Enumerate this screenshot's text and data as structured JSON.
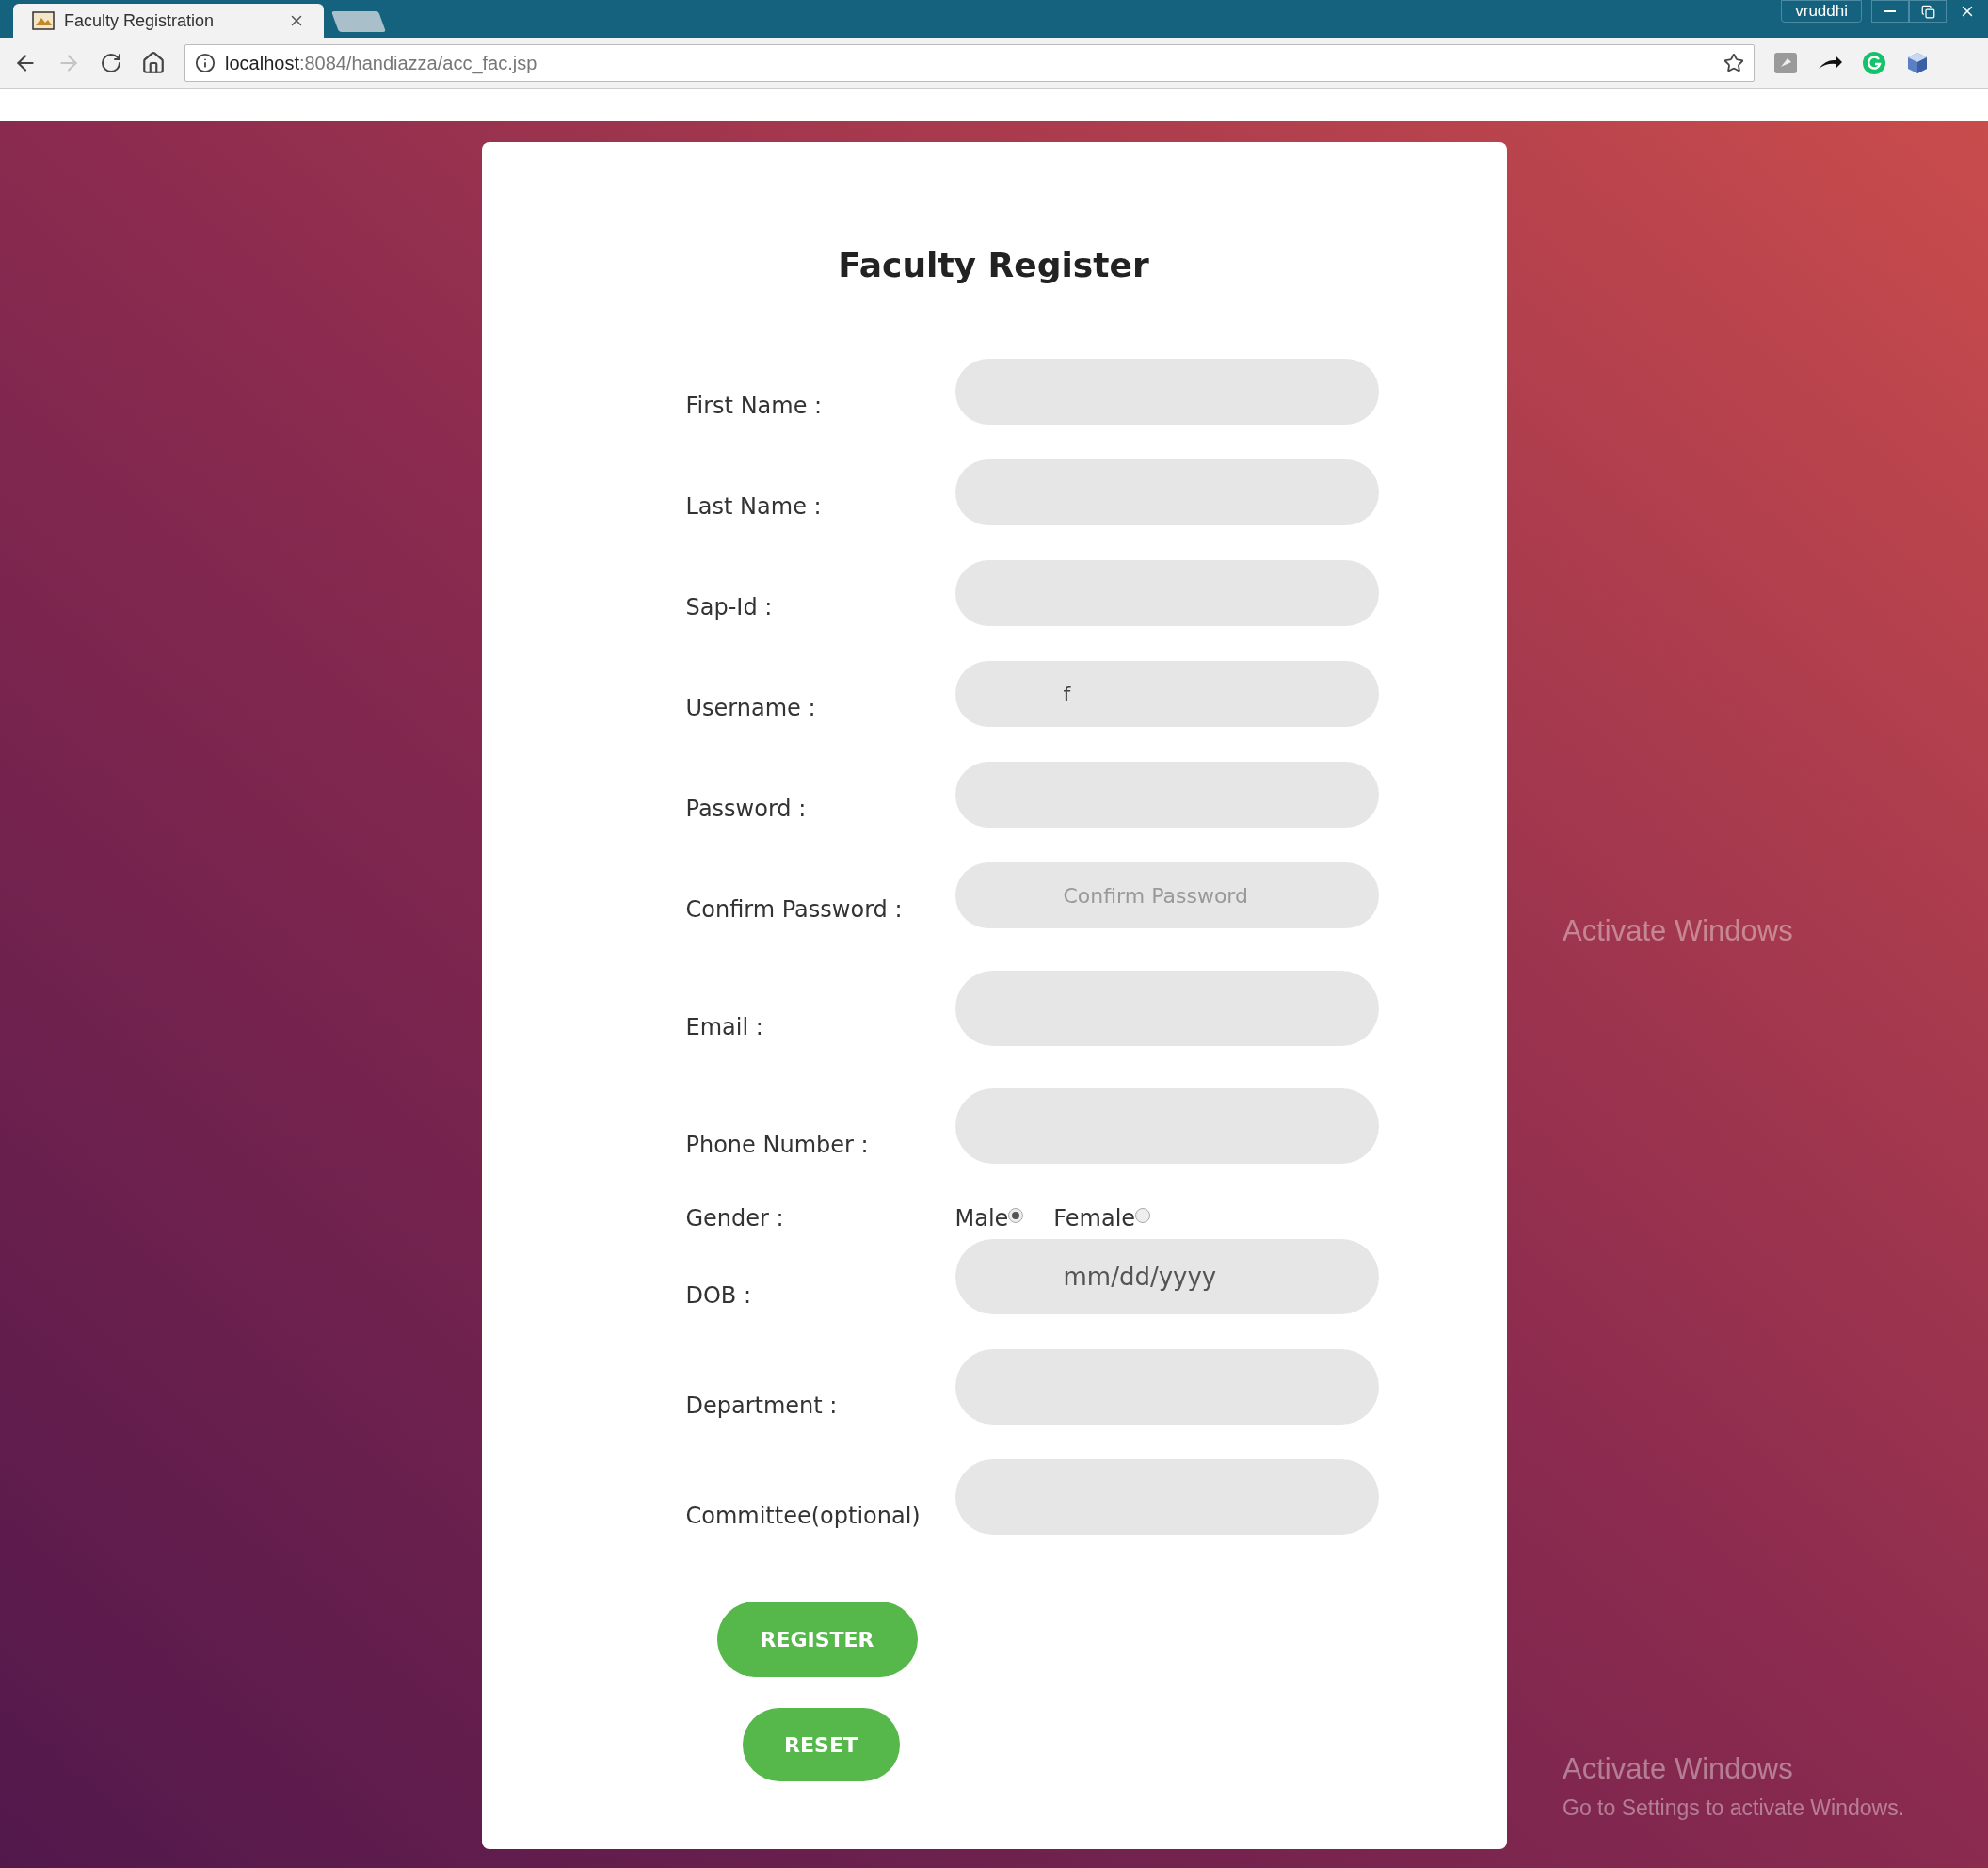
{
  "browser": {
    "tab": {
      "title": "Faculty Registration",
      "selected": true
    },
    "profile": "vruddhi",
    "navigation": {
      "back_disabled": false,
      "forward_disabled": true
    },
    "url": {
      "host": "localhost",
      "path": ":8084/handiazza/acc_fac.jsp"
    }
  },
  "form": {
    "title": "Faculty Register",
    "fields": [
      {
        "label": "First Name :",
        "kind": "text"
      },
      {
        "label": "Last Name :",
        "kind": "text"
      },
      {
        "label": "Sap-Id :",
        "kind": "text"
      },
      {
        "label": "Username :",
        "kind": "text",
        "value": "f"
      },
      {
        "label": "Password :",
        "kind": "text"
      },
      {
        "label": "Confirm Password :",
        "kind": "text",
        "placeholder": "Confirm Password"
      },
      {
        "label": "Email :",
        "kind": "text"
      },
      {
        "label": "Phone Number :",
        "kind": "text"
      },
      {
        "label": "Gender :",
        "kind": "radio",
        "options": [
          {
            "label": "Male",
            "selected": true
          },
          {
            "label": "Female",
            "selected": false
          }
        ]
      },
      {
        "label": "DOB :",
        "kind": "date",
        "placeholder": "mm/dd/yyyy"
      },
      {
        "label": "Department :",
        "kind": "text"
      },
      {
        "label": "Committee(optional)",
        "kind": "text"
      }
    ],
    "buttons": [
      {
        "label": "REGISTER"
      },
      {
        "label": "RESET"
      }
    ]
  },
  "os_notices": [
    {
      "title": "Activate Windows"
    },
    {
      "title": "Activate Windows",
      "subtitle": "Go to Settings to activate Windows."
    }
  ]
}
